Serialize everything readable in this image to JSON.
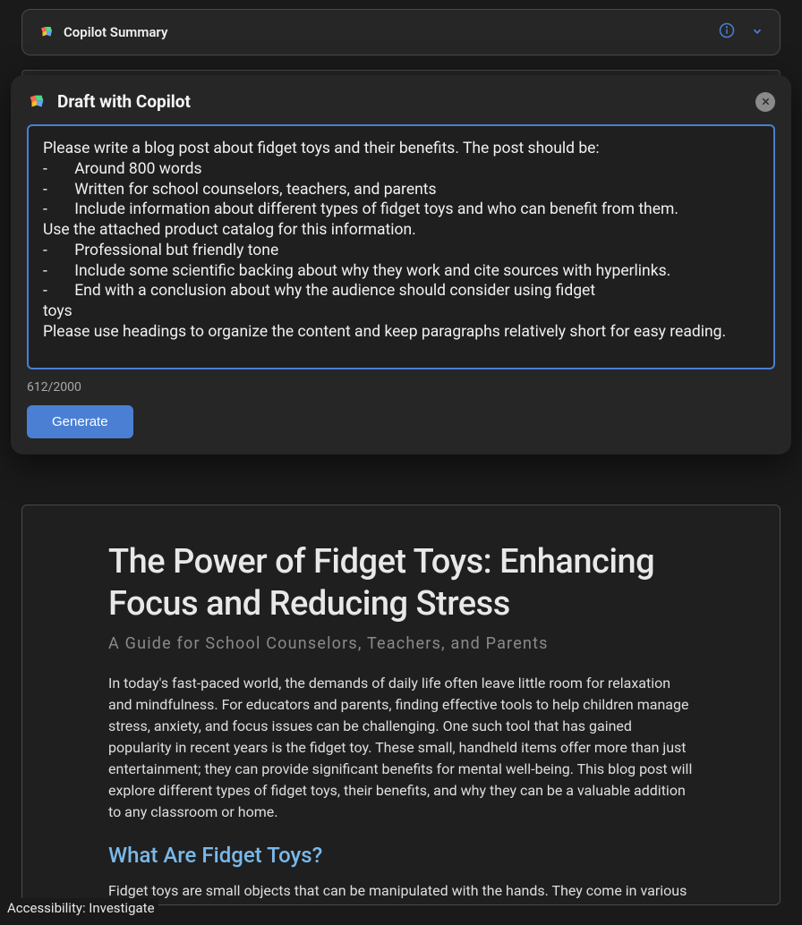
{
  "topPanel": {
    "title": "Copilot Summary"
  },
  "dialog": {
    "title": "Draft with Copilot",
    "prompt_intro": "Please write a blog post about fidget toys and their benefits. The post should be:",
    "prompt_bullets": [
      "Around 800 words",
      "Written for school counselors, teachers, and parents",
      "Include information about different types of fidget toys and who can benefit from them."
    ],
    "prompt_mid": "Use the attached product catalog for this information.",
    "prompt_bullets2": [
      "Professional but friendly tone",
      "Include some scientific backing about why they work and cite sources with hyperlinks.",
      "End with a conclusion about why the audience should consider using fidget"
    ],
    "prompt_tail1": "toys",
    "prompt_tail2": "Please use headings to organize the content and keep paragraphs relatively short for easy reading.",
    "char_count": "612/2000",
    "generate_label": "Generate"
  },
  "document": {
    "title": "The Power of Fidget Toys: Enhancing Focus and Reducing Stress",
    "subtitle": "A Guide for School Counselors, Teachers, and Parents",
    "intro": "In today's fast-paced world, the demands of daily life often leave little room for relaxation and mindfulness. For educators and parents, finding effective tools to help children manage stress, anxiety, and focus issues can be challenging. One such tool that has gained popularity in recent years is the fidget toy. These small, handheld items offer more than just entertainment; they can provide significant benefits for mental well-being. This blog post will explore different types of fidget toys, their benefits, and why they can be a valuable addition to any classroom or home.",
    "heading1": "What Are Fidget Toys?",
    "para1": "Fidget toys are small objects that can be manipulated with the hands. They come in various"
  },
  "statusBar": {
    "text": "Accessibility: Investigate"
  }
}
